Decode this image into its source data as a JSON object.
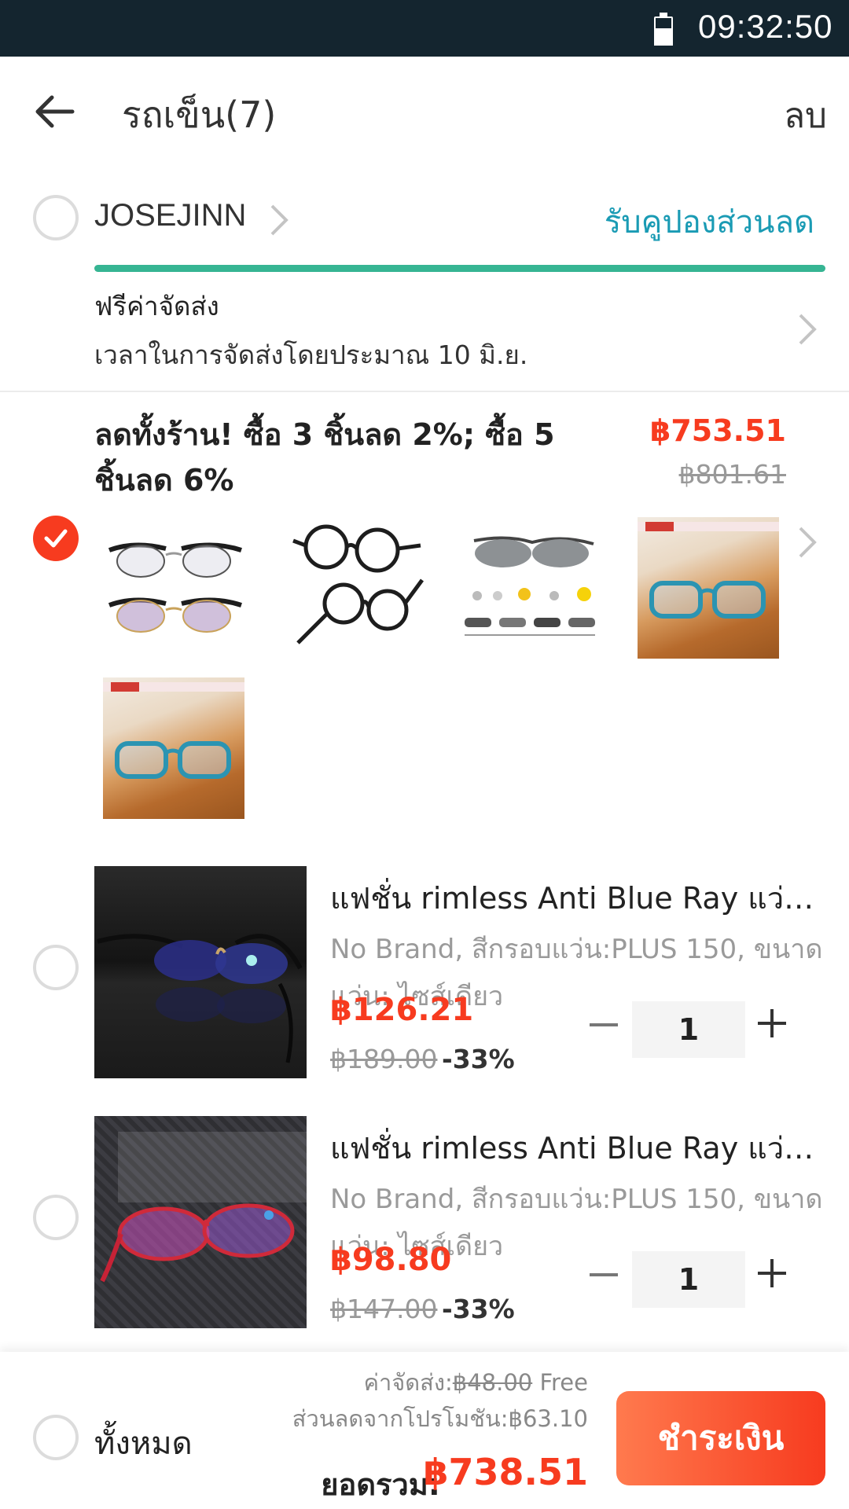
{
  "status_bar": {
    "time": "09:32:50"
  },
  "header": {
    "title": "รถเข็น(7)",
    "delete_label": "ลบ"
  },
  "shop": {
    "name": "JOSEJINN",
    "coupon_label": "รับคูปองส่วนลด",
    "free_shipping_progress": 1.0
  },
  "shipping": {
    "title": "ฟรีค่าจัดส่ง",
    "time_text": "เวลาในการจัดส่งโดยประมาณ 10 มิ.ย."
  },
  "promo": {
    "text": "ลดทั้งร้าน! ซื้อ 3 ชิ้นลด 2%; ซื้อ 5 ชิ้นลด 6%",
    "price": "฿753.51",
    "original_price": "฿801.61",
    "checked": true
  },
  "items": [
    {
      "title": "แฟชั่น rimless Anti Blue Ray แว่นตาอ่านหนังสือ",
      "variant": "No Brand, สีกรอบแว่น:PLUS 150, ขนาดแว่น: ไซส์เดียว",
      "price": "฿126.21",
      "original_price": "฿189.00",
      "discount": "-33%",
      "quantity": "1"
    },
    {
      "title": "แฟชั่น rimless Anti Blue Ray แว่นตาอ่านหนังสือ",
      "variant": "No Brand, สีกรอบแว่น:PLUS 150, ขนาดแว่น: ไซส์เดียว",
      "price": "฿98.80",
      "original_price": "฿147.00",
      "discount": "-33%",
      "quantity": "1"
    }
  ],
  "footer": {
    "all_label": "ทั้งหมด",
    "shipping_fee_label": "ค่าจัดส่ง:",
    "shipping_fee_value": "฿48.00",
    "shipping_fee_free": " Free",
    "promo_discount": "ส่วนลดจากโปรโมชัน:฿63.10",
    "total_label": "ยอดรวม:",
    "total_value": "฿738.51",
    "checkout_label": "ชำระเงิน"
  },
  "colors": {
    "accent": "#f73b1f",
    "link": "#1a9bb4",
    "progress": "#36b593",
    "status_bar": "#14252f"
  },
  "icons": [
    "battery-icon",
    "back-arrow-icon",
    "chevron-right-icon",
    "check-icon",
    "minus-icon",
    "plus-icon"
  ]
}
